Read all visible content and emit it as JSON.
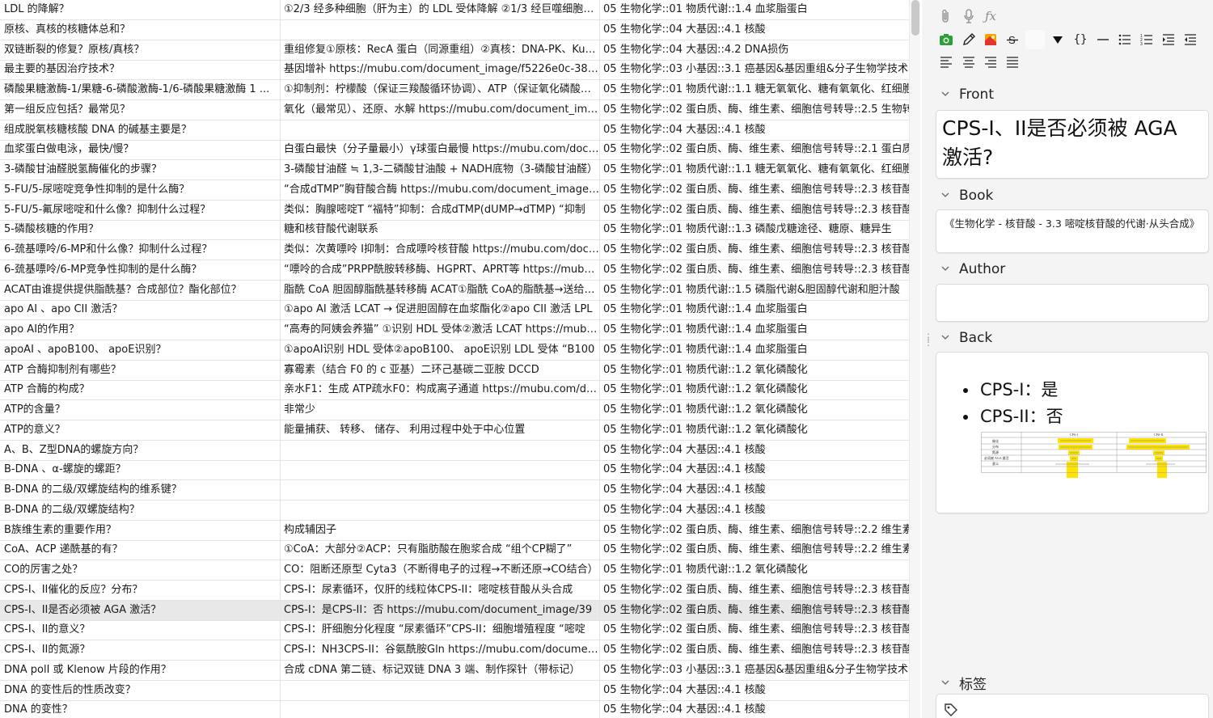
{
  "table": {
    "rows": [
      {
        "sort": "LDL 的降解？",
        "answer": "①2/3 经多种细胞（肝为主）的 LDL 受体降解 ②1/3 经巨噬细胞清除",
        "deck": "05 生物化学::01 物质代谢::1.4 血浆脂蛋白"
      },
      {
        "sort": "原核、真核的核糖体总和？",
        "answer": "",
        "deck": "05 生物化学::04 大基因::4.1 核酸"
      },
      {
        "sort": "双链断裂的修复？原核/真核？",
        "answer": "重组修复①原核：RecA 蛋白（同源重组）②真核：DNA-PK、Ku蛋白",
        "deck": "05 生物化学::04 大基因::4.2 DNA损伤"
      },
      {
        "sort": "最主要的基因治疗技术？",
        "answer": "基因增补  https://mubu.com/document_image/f5226e0c-38c3-4c",
        "deck": "05 生物化学::03 小基因::3.1 癌基因&基因重组&分子生物学技术"
      },
      {
        "sort": "磷酸果糖激酶-1/果糖-6-磷酸激酶-1/6-磷酸果糖激酶 1 ...",
        "answer": "①抑制剂：柠檬酸（保证三羧酸循环协调）、ATP（保证氧化磷酸化）",
        "deck": "05 生物化学::01 物质代谢::1.1 糖无氧氧化、糖有氧氧化、红细胞"
      },
      {
        "sort": "第一组反应包括？最常见？",
        "answer": "氧化（最常见）、还原、水解  https://mubu.com/document_image",
        "deck": "05 生物化学::02 蛋白质、酶、维生素、细胞信号转导::2.5 生物转化"
      },
      {
        "sort": "组成脱氧核糖核酸 DNA 的碱基主要是？",
        "answer": "",
        "deck": "05 生物化学::04 大基因::4.1 核酸"
      },
      {
        "sort": "血浆蛋白做电泳，最快/慢？",
        "answer": "白蛋白最快（分子量最小）γ球蛋白最慢  https://mubu.com/document",
        "deck": "05 生物化学::02 蛋白质、酶、维生素、细胞信号转导::2.1 蛋白质"
      },
      {
        "sort": "3-磷酸甘油醛脱氢酶催化的步骤？",
        "answer": "3-磷酸甘油醛 ≒ 1,3-二磷酸甘油酸 + NADH底物（3-磷酸甘油醛）",
        "deck": "05 生物化学::01 物质代谢::1.1 糖无氧氧化、糖有氧氧化、红细胞"
      },
      {
        "sort": "5-FU/5-尿嘧啶竞争性抑制的是什么酶？",
        "answer": "“合成dTMP”胸苷酸合酶  https://mubu.com/document_image/2a",
        "deck": "05 生物化学::02 蛋白质、酶、维生素、细胞信号转导::2.3 核苷酸"
      },
      {
        "sort": "5-FU/5-氟尿嘧啶和什么像？抑制什么过程？",
        "answer": "类似：胸腺嘧啶T “福特”抑制：合成dTMP(dUMP→dTMP) “抑制",
        "deck": "05 生物化学::02 蛋白质、酶、维生素、细胞信号转导::2.3 核苷酸"
      },
      {
        "sort": "5-磷酸核糖的作用？",
        "answer": "糖和核苷酸代谢联系",
        "deck": "05 生物化学::01 物质代谢::1.3 磷酸戊糖途径、糖原、糖异生"
      },
      {
        "sort": "6-巯基嘌呤/6-MP和什么像？抑制什么过程？",
        "answer": "类似：次黄嘌呤 I抑制：合成嘌呤核苷酸  https://mubu.com/document",
        "deck": "05 生物化学::02 蛋白质、酶、维生素、细胞信号转导::2.3 核苷酸"
      },
      {
        "sort": "6-巯基嘌呤/6-MP竞争性抑制的是什么酶？",
        "answer": "“嘌呤的合成”PRPP酰胺转移酶、HGPRT、APRT等  https://mubu.com",
        "deck": "05 生物化学::02 蛋白质、酶、维生素、细胞信号转导::2.3 核苷酸"
      },
      {
        "sort": "ACAT由谁提供提供脂酰基？合成部位？酯化部位？",
        "answer": "脂酰 CoA 胆固醇脂酰基转移酶 ACAT①脂酰 CoA的脂酰基→送给胆固醇",
        "deck": "05 生物化学::01 物质代谢::1.5 磷脂代谢&胆固醇代谢和胆汁酸"
      },
      {
        "sort": "apo AI 、apo CII 激活？",
        "answer": "①apo AI 激活 LCAT → 促进胆固醇在血浆酯化②apo CII 激活 LPL",
        "deck": "05 生物化学::01 物质代谢::1.4 血浆脂蛋白"
      },
      {
        "sort": "apo AI的作用？",
        "answer": "“高寿的阿姨会养猫” ①识别 HDL 受体②激活 LCAT  https://mubu.com",
        "deck": "05 生物化学::01 物质代谢::1.4 血浆脂蛋白"
      },
      {
        "sort": "apoAI 、apoB100、 apoE识别？",
        "answer": "①apoAI识别 HDL 受体②apoB100、 apoE识别 LDL 受体  “B100",
        "deck": "05 生物化学::01 物质代谢::1.4 血浆脂蛋白"
      },
      {
        "sort": "ATP 合酶抑制剂有哪些？",
        "answer": "寡霉素（结合 F0 的 c 亚基）二环己基碳二亚胺 DCCD",
        "deck": "05 生物化学::01 物质代谢::1.2 氧化磷酸化"
      },
      {
        "sort": "ATP 合酶的构成？",
        "answer": "亲水F1：生成 ATP疏水F0：构成离子通道  https://mubu.com/document",
        "deck": "05 生物化学::01 物质代谢::1.2 氧化磷酸化"
      },
      {
        "sort": "ATP的含量？",
        "answer": "非常少",
        "deck": "05 生物化学::01 物质代谢::1.2 氧化磷酸化"
      },
      {
        "sort": "ATP的意义？",
        "answer": "能量捕获、 转移、 储存、 利用过程中处于中心位置",
        "deck": "05 生物化学::01 物质代谢::1.2 氧化磷酸化"
      },
      {
        "sort": "A、B、Z型DNA的螺旋方向？",
        "answer": "",
        "deck": "05 生物化学::04 大基因::4.1 核酸"
      },
      {
        "sort": "B-DNA 、α-螺旋的螺距？",
        "answer": "",
        "deck": "05 生物化学::04 大基因::4.1 核酸"
      },
      {
        "sort": "B-DNA 的二级/双螺旋结构的维系键？",
        "answer": "",
        "deck": "05 生物化学::04 大基因::4.1 核酸"
      },
      {
        "sort": "B-DNA 的二级/双螺旋结构？",
        "answer": "",
        "deck": "05 生物化学::04 大基因::4.1 核酸"
      },
      {
        "sort": "B族维生素的重要作用？",
        "answer": "构成辅因子",
        "deck": "05 生物化学::02 蛋白质、酶、维生素、细胞信号转导::2.2 维生素"
      },
      {
        "sort": "CoA、ACP 递酰基的有？",
        "answer": "①CoA：大部分②ACP：只有脂肪酸在胞浆合成 “组个CP糊了”",
        "deck": "05 生物化学::02 蛋白质、酶、维生素、细胞信号转导::2.2 维生素"
      },
      {
        "sort": "CO的厉害之处？",
        "answer": "CO：阻断还原型 Cyta3（不断得电子的过程→不断还原→CO结合）",
        "deck": "05 生物化学::01 物质代谢::1.2 氧化磷酸化"
      },
      {
        "sort": "CPS-I、II催化的反应？分布？",
        "answer": "CPS-I：尿素循环，仅肝的线粒体CPS-II：嘧啶核苷酸从头合成",
        "deck": "05 生物化学::02 蛋白质、酶、维生素、细胞信号转导::2.3 核苷酸"
      },
      {
        "sort": "CPS-I、II是否必须被 AGA 激活？",
        "answer": "CPS-I：是CPS-II：否  https://mubu.com/document_image/39",
        "deck": "05 生物化学::02 蛋白质、酶、维生素、细胞信号转导::2.3 核苷酸"
      },
      {
        "sort": "CPS-I、II的意义？",
        "answer": "CPS-I：肝细胞分化程度 “尿素循环”CPS-II：细胞增殖程度 “嘧啶",
        "deck": "05 生物化学::02 蛋白质、酶、维生素、细胞信号转导::2.3 核苷酸"
      },
      {
        "sort": "CPS-I、II的氮源？",
        "answer": "CPS-I：NH3CPS-II：谷氨酰胺Gln  https://mubu.com/document_image",
        "deck": "05 生物化学::02 蛋白质、酶、维生素、细胞信号转导::2.3 核苷酸"
      },
      {
        "sort": "DNA polI 或 Klenow 片段的作用？",
        "answer": "合成 cDNA 第二链、标记双链 DNA 3 端、制作探针（带标记）",
        "deck": "05 生物化学::03 小基因::3.1 癌基因&基因重组&分子生物学技术"
      },
      {
        "sort": "DNA 的变性后的性质改变？",
        "answer": "",
        "deck": "05 生物化学::04 大基因::4.1 核酸"
      },
      {
        "sort": "DNA 的变性？",
        "answer": "",
        "deck": "05 生物化学::04 大基因::4.1 核酸"
      }
    ],
    "selected_index": 30
  },
  "editor": {
    "toolbar_icons": [
      "paperclip-icon",
      "microphone-icon",
      "function-icon",
      "image-icon",
      "pencil-icon",
      "color-swatch-icon",
      "strikethrough-icon",
      "blank-icon",
      "dropdown-triangle-icon",
      "braces-icon",
      "horizontal-rule-icon",
      "bullet-list-icon",
      "numbered-list-icon",
      "indent-icon",
      "outdent-icon",
      "align-left-icon",
      "align-center-icon",
      "align-right-icon",
      "justify-icon"
    ],
    "fields": {
      "front_label": "Front",
      "front_value": "CPS-I、II是否必须被 AGA 激活?",
      "book_label": "Book",
      "book_value": "《生物化学 - 核苷酸 - 3.3 嘧啶核苷酸的代谢·从头合成》",
      "author_label": "Author",
      "author_value": "",
      "back_label": "Back",
      "back_items": [
        "CPS-I：是",
        "CPS-II：否"
      ],
      "tags_label": "标签"
    },
    "back_figure": {
      "headers": [
        "CPS-I",
        "CPS-II"
      ],
      "row_labels": [
        "催化",
        "分布",
        "氮源",
        "必须被 AGA 激活",
        "意义"
      ],
      "highlight_color": "#ffe400"
    }
  },
  "colors": {
    "selected_row": "#e8e8e8",
    "editor_bg": "#f4f4f4",
    "field_bg": "#ffffff"
  }
}
